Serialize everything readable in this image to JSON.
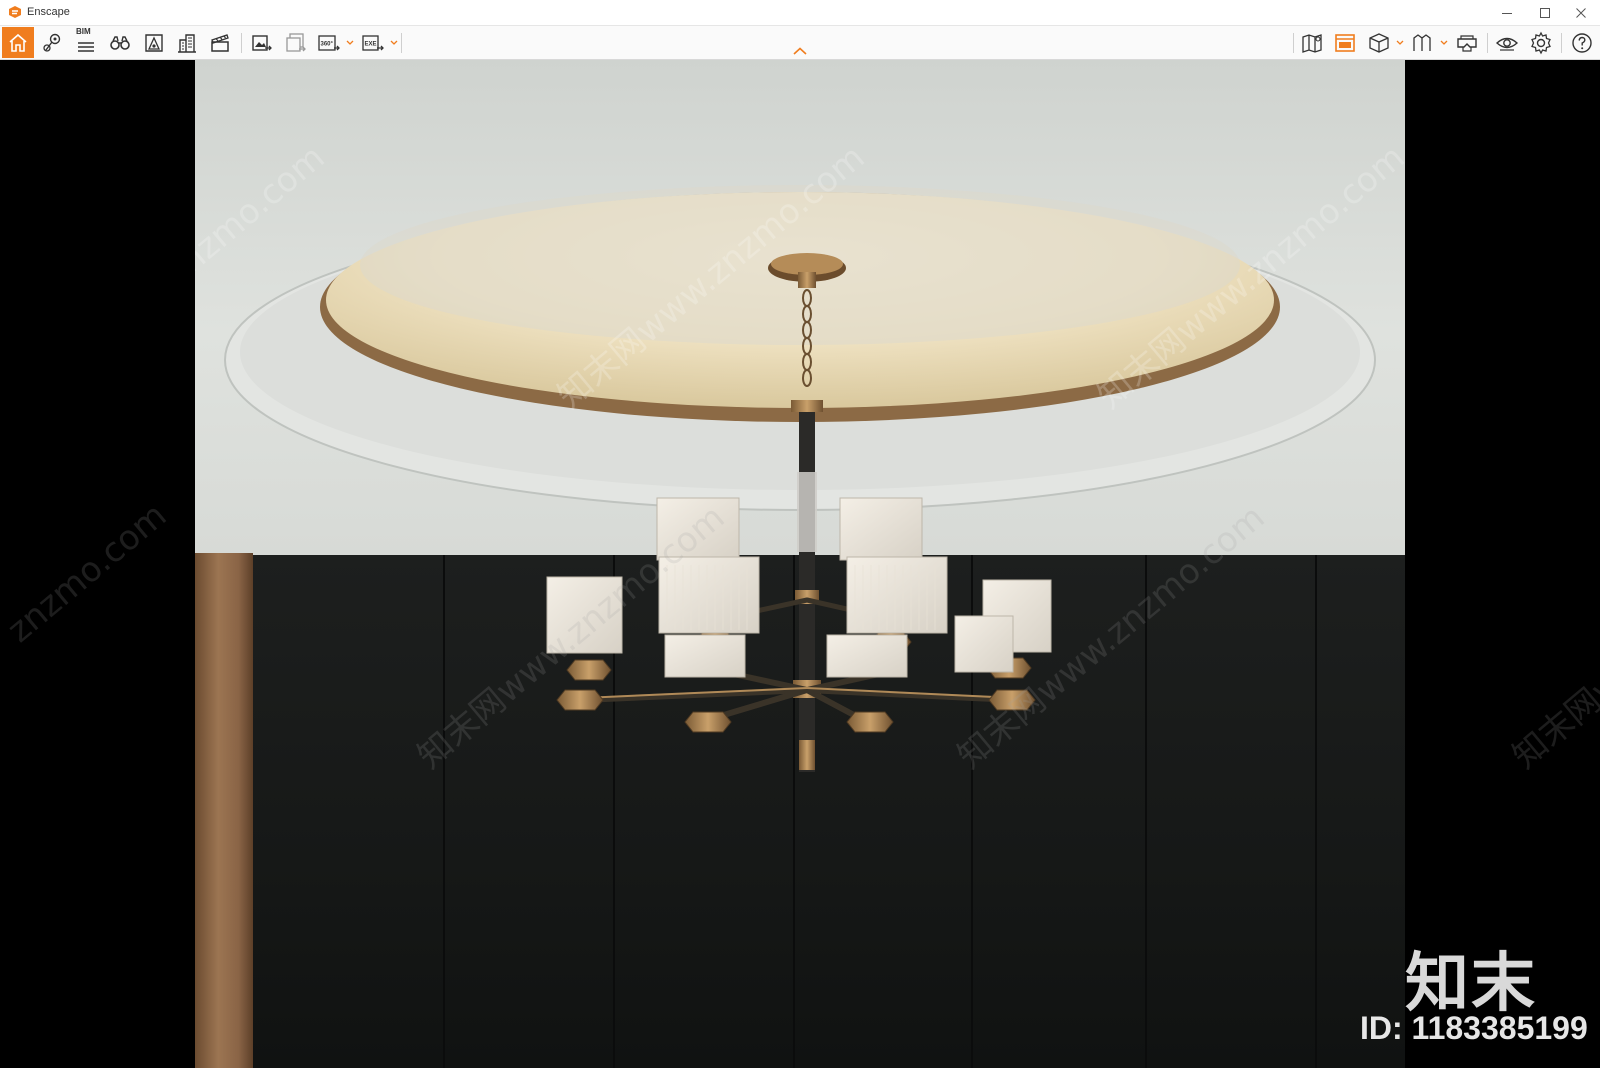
{
  "window": {
    "title": "Enscape",
    "controls": {
      "minimize_icon": "minimize-icon",
      "maximize_icon": "maximize-icon",
      "close_icon": "close-icon"
    }
  },
  "toolbar": {
    "accent_color": "#f07d1e",
    "left_tools": [
      {
        "id": "home",
        "icon": "home-icon",
        "active": true
      },
      {
        "id": "views",
        "icon": "view-location-icon"
      },
      {
        "id": "bim",
        "icon": "bim-list-icon",
        "label": "BIM"
      },
      {
        "id": "binoculars",
        "icon": "binoculars-icon"
      },
      {
        "id": "asset",
        "icon": "asset-library-icon"
      },
      {
        "id": "buildings",
        "icon": "buildings-icon"
      },
      {
        "id": "video",
        "icon": "video-editor-icon"
      },
      {
        "id": "render",
        "icon": "screenshot-export-icon"
      },
      {
        "id": "batch",
        "icon": "batch-render-icon"
      },
      {
        "id": "pano",
        "icon": "panorama-360-icon",
        "label": "360°"
      },
      {
        "id": "exe",
        "icon": "exe-export-icon",
        "label": "EXE"
      }
    ],
    "right_tools": [
      {
        "id": "map",
        "icon": "map-icon"
      },
      {
        "id": "web",
        "icon": "web-standalone-icon"
      },
      {
        "id": "cube",
        "icon": "cube-view-icon"
      },
      {
        "id": "measure",
        "icon": "measure-icon"
      },
      {
        "id": "vr",
        "icon": "vr-headset-icon"
      },
      {
        "id": "eye",
        "icon": "visual-settings-icon"
      },
      {
        "id": "gear",
        "icon": "gear-icon"
      },
      {
        "id": "help",
        "icon": "help-icon"
      }
    ]
  },
  "viewport": {
    "scene": "chandelier-render",
    "watermarks": {
      "site": "知末网www.znzmo.com",
      "site_short": "znzmo.com",
      "brand": "知末",
      "id_text": "ID: 1183385199"
    }
  }
}
